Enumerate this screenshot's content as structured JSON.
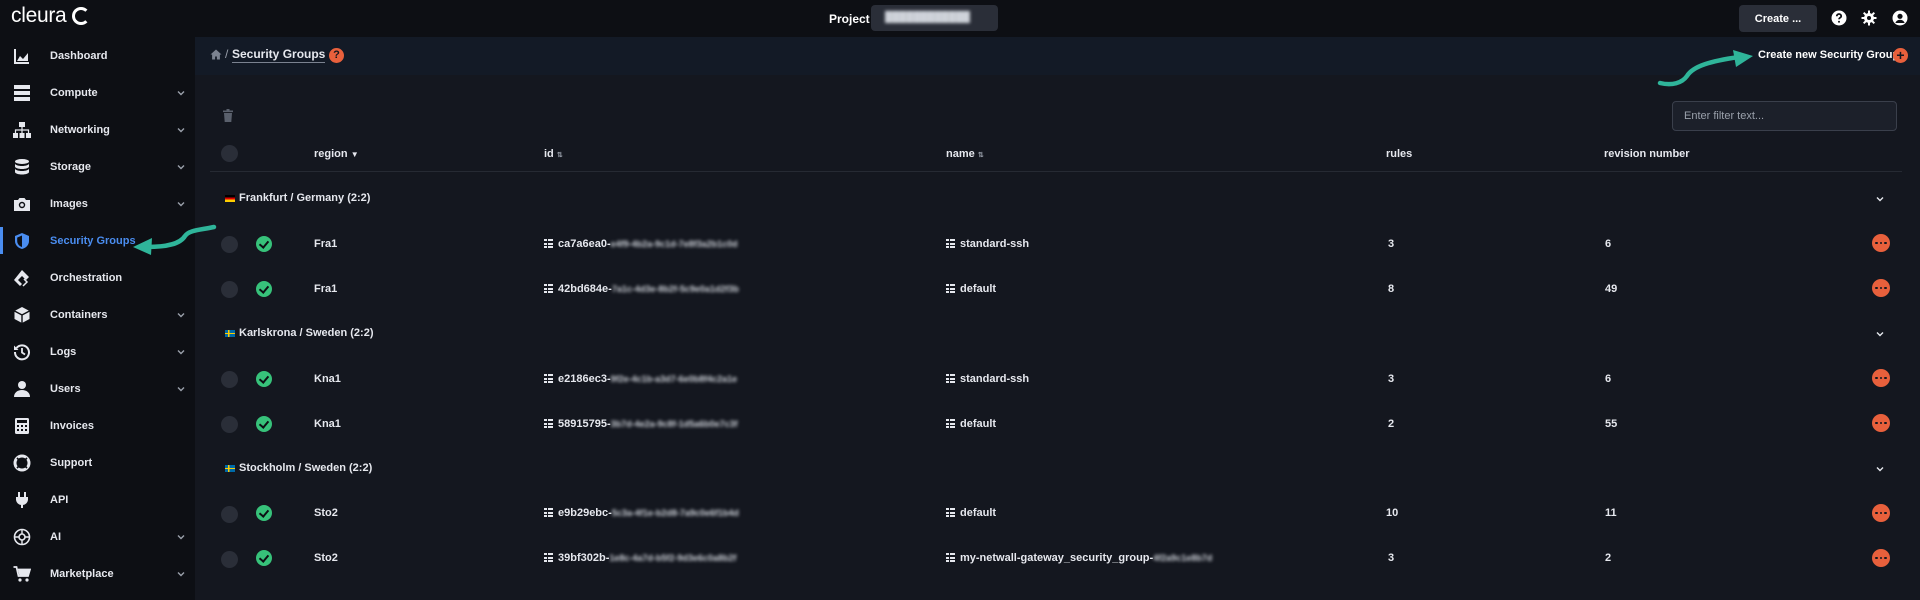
{
  "app": {
    "brand": "cleura"
  },
  "topbar": {
    "project_label": "Project",
    "project_value": "████████████",
    "create_label": "Create ...",
    "icons": [
      "help-circle-icon",
      "gear-icon",
      "user-circle-icon"
    ]
  },
  "sidebar": {
    "items": [
      {
        "label": "Dashboard",
        "icon": "chart-area-icon",
        "chevron": false,
        "active": false
      },
      {
        "label": "Compute",
        "icon": "server-icon",
        "chevron": true,
        "active": false
      },
      {
        "label": "Networking",
        "icon": "network-icon",
        "chevron": true,
        "active": false
      },
      {
        "label": "Storage",
        "icon": "database-icon",
        "chevron": true,
        "active": false
      },
      {
        "label": "Images",
        "icon": "camera-icon",
        "chevron": true,
        "active": false
      },
      {
        "label": "Security Groups",
        "icon": "shield-icon",
        "chevron": false,
        "active": true
      },
      {
        "label": "Orchestration",
        "icon": "orchestration-icon",
        "chevron": false,
        "active": false
      },
      {
        "label": "Containers",
        "icon": "cube-icon",
        "chevron": true,
        "active": false
      },
      {
        "label": "Logs",
        "icon": "history-icon",
        "chevron": true,
        "active": false
      },
      {
        "label": "Users",
        "icon": "user-icon",
        "chevron": true,
        "active": false
      },
      {
        "label": "Invoices",
        "icon": "calculator-icon",
        "chevron": false,
        "active": false
      },
      {
        "label": "Support",
        "icon": "lifebuoy-icon",
        "chevron": false,
        "active": false
      },
      {
        "label": "API",
        "icon": "plug-icon",
        "chevron": false,
        "active": false
      },
      {
        "label": "AI",
        "icon": "ai-icon",
        "chevron": true,
        "active": false
      },
      {
        "label": "Marketplace",
        "icon": "cart-icon",
        "chevron": true,
        "active": false
      }
    ]
  },
  "header": {
    "breadcrumb_sep": "/",
    "title": "Security Groups",
    "help": "?",
    "create_new_label": "Create new Security Group",
    "create_new_plus": "+"
  },
  "filter": {
    "placeholder": "Enter filter text..."
  },
  "table": {
    "columns": {
      "region": "region",
      "id": "id",
      "name": "name",
      "rules": "rules",
      "revision": "revision number"
    },
    "groups": [
      {
        "title": "Frankfurt / Germany (2:2)",
        "flag": "germany",
        "rows": [
          {
            "region": "Fra1",
            "id_prefix": "ca7a6ea0-",
            "id_hidden": "e4f9-4b2a-9c1d-7e8f3a2b1c0d",
            "name": "standard-ssh",
            "rules": "3",
            "revision": "6"
          },
          {
            "region": "Fra1",
            "id_prefix": "42bd684e-",
            "id_hidden": "7a1c-4d3e-8b2f-5c9e0a1d2f3b",
            "name": "default",
            "rules": "8",
            "revision": "49"
          }
        ]
      },
      {
        "title": "Karlskrona / Sweden (2:2)",
        "flag": "sweden",
        "rows": [
          {
            "region": "Kna1",
            "id_prefix": "e2186ec3-",
            "id_hidden": "9f2e-4c1b-a3d7-6e0b8f4c2a1e",
            "name": "standard-ssh",
            "rules": "3",
            "revision": "6"
          },
          {
            "region": "Kna1",
            "id_prefix": "58915795-",
            "id_hidden": "3b7d-4e2a-9c8f-1d5a6b0e7c3f",
            "name": "default",
            "rules": "2",
            "revision": "55"
          }
        ]
      },
      {
        "title": "Stockholm / Sweden (2:2)",
        "flag": "sweden",
        "rows": [
          {
            "region": "Sto2",
            "id_prefix": "e9b29ebc-",
            "id_hidden": "5c3a-4f1e-b2d8-7a9c0e6f1b4d",
            "name": "default",
            "rules": "10",
            "revision": "11"
          },
          {
            "region": "Sto2",
            "id_prefix": "39bf302b-",
            "id_hidden": "1e8c-4a7d-b5f2-9d3e6c0a8b2f",
            "name_prefix": "my-netwall-gateway_security_group-",
            "name_hidden": "4f2a9c1e8b7d",
            "rules": "3",
            "revision": "2"
          }
        ]
      }
    ]
  },
  "colors": {
    "accent_blue": "#4a8df0",
    "accent_orange": "#e8603c",
    "success_green": "#37c27a",
    "arrow_teal": "#2fb59a"
  }
}
